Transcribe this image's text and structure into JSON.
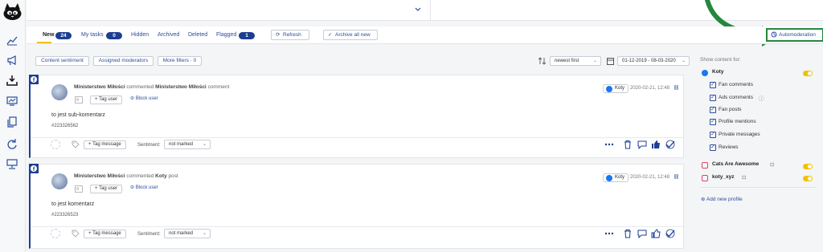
{
  "tabs": [
    {
      "label": "New",
      "count": "24"
    },
    {
      "label": "My tasks",
      "count": "0"
    },
    {
      "label": "Hidden"
    },
    {
      "label": "Archived"
    },
    {
      "label": "Deleted"
    },
    {
      "label": "Flagged",
      "count": "1"
    }
  ],
  "toolbar": {
    "refresh": "Refresh",
    "archive_all": "Archive all new",
    "automoderation": "Automoderation"
  },
  "filters": {
    "content_sentiment": "Content sentiment",
    "assigned_moderators": "Assigned moderators",
    "more_filters": "More filters · 0",
    "sort": "newest first",
    "date_range": "01-12-2019 - 08-03-2020"
  },
  "posts": [
    {
      "author": "Ministerstwo Miłości",
      "action": "commented",
      "target": "Ministerstwo Miłości",
      "kind": "comment",
      "page": "Koty",
      "date": "2020-02-21, 12:48",
      "text": "to jest sub-komentarz",
      "id": "#223326562",
      "tag_user": "+ Tag user",
      "block_user": "Block user",
      "tag_message": "+ Tag message",
      "sentiment_label": "Sentiment:",
      "sentiment": "not marked"
    },
    {
      "author": "Ministerstwo Miłości",
      "action": "commented",
      "target": "Koty",
      "kind": "post",
      "page": "Koty",
      "date": "2020-02-21, 12:48",
      "text": "to jest komentarz",
      "id": "#223326523",
      "tag_user": "+ Tag user",
      "block_user": "Block user",
      "tag_message": "+ Tag message",
      "sentiment_label": "Sentiment:",
      "sentiment": "not marked"
    }
  ],
  "right_panel": {
    "show_for": "Show content for:",
    "profiles": [
      {
        "name": "Koty",
        "network": "facebook",
        "enabled": true,
        "options": [
          "Fan comments",
          "Ads comments",
          "Fan posts",
          "Profile mentions",
          "Private messages",
          "Reviews"
        ]
      },
      {
        "name": "Cats Are Awesome",
        "network": "instagram",
        "enabled": true
      },
      {
        "name": "koty_xyz",
        "network": "instagram",
        "enabled": true
      }
    ],
    "add_profile": "Add new profile"
  },
  "colors": {
    "primary": "#1d3f91",
    "link": "#2b4d9c",
    "accent": "#f2c200",
    "highlight": "#23883e",
    "instagram": "#e4405f",
    "facebook": "#1877f2"
  }
}
